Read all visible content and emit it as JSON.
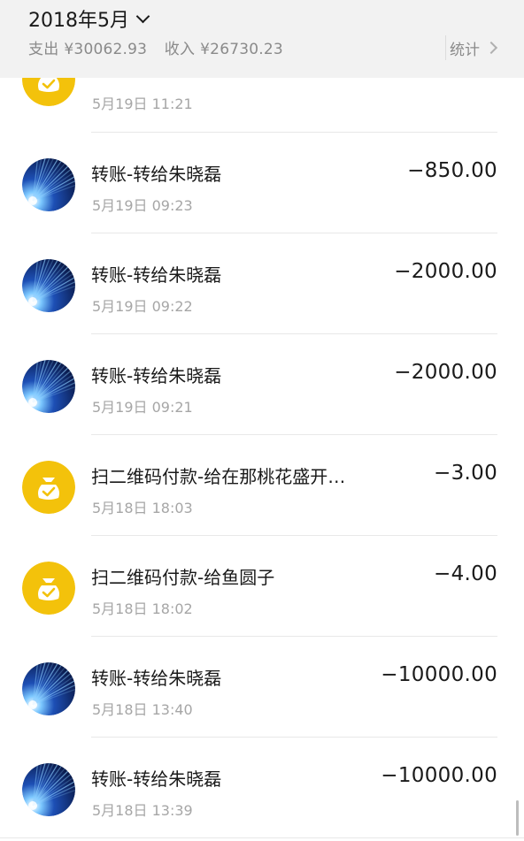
{
  "header": {
    "month": "2018年5月",
    "expense_label": "支出",
    "expense_value": "¥30062.93",
    "income_label": "收入",
    "income_value": "¥26730.23",
    "stats_label": "统计"
  },
  "colors": {
    "header_bg": "#f2f2f2",
    "wallet_yellow": "#f3c20b",
    "transfer_blue": "#1c3d8f",
    "text_primary": "#1a1a1a",
    "text_secondary": "#a6a6a6"
  },
  "transactions": [
    {
      "title": "",
      "time": "5月19日 11:21",
      "amount": "",
      "icon": "wallet-icon"
    },
    {
      "title": "转账-转给朱晓磊",
      "time": "5月19日 09:23",
      "amount": "−850.00",
      "icon": "transfer-avatar"
    },
    {
      "title": "转账-转给朱晓磊",
      "time": "5月19日 09:22",
      "amount": "−2000.00",
      "icon": "transfer-avatar"
    },
    {
      "title": "转账-转给朱晓磊",
      "time": "5月19日 09:21",
      "amount": "−2000.00",
      "icon": "transfer-avatar"
    },
    {
      "title": "扫二维码付款-给在那桃花盛开…",
      "time": "5月18日 18:03",
      "amount": "−3.00",
      "icon": "wallet-icon"
    },
    {
      "title": "扫二维码付款-给鱼圆子",
      "time": "5月18日 18:02",
      "amount": "−4.00",
      "icon": "wallet-icon"
    },
    {
      "title": "转账-转给朱晓磊",
      "time": "5月18日 13:40",
      "amount": "−10000.00",
      "icon": "transfer-avatar"
    },
    {
      "title": "转账-转给朱晓磊",
      "time": "5月18日 13:39",
      "amount": "−10000.00",
      "icon": "transfer-avatar"
    }
  ]
}
